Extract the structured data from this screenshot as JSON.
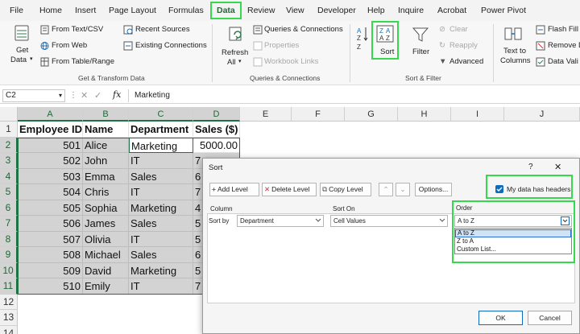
{
  "menu_tabs": [
    "File",
    "Home",
    "Insert",
    "Page Layout",
    "Formulas",
    "Data",
    "Review",
    "View",
    "Developer",
    "Help",
    "Inquire",
    "Acrobat",
    "Power Pivot"
  ],
  "active_tab": "Data",
  "ribbon": {
    "get_data": "Get",
    "get_data2": "Data",
    "from_text_csv": "From Text/CSV",
    "from_web": "From Web",
    "from_table_range": "From Table/Range",
    "recent_sources": "Recent Sources",
    "existing_connections": "Existing Connections",
    "group_get_transform": "Get & Transform Data",
    "refresh": "Refresh",
    "refresh_all": "All",
    "queries_connections": "Queries & Connections",
    "properties": "Properties",
    "workbook_links": "Workbook Links",
    "group_queries": "Queries & Connections",
    "sort": "Sort",
    "filter": "Filter",
    "clear": "Clear",
    "reapply": "Reapply",
    "advanced": "Advanced",
    "group_sort_filter": "Sort & Filter",
    "text_to": "Text to",
    "columns": "Columns",
    "flash_fill": "Flash Fill",
    "remove_dup": "Remove D",
    "data_valid": "Data Vali"
  },
  "formula_bar": {
    "name_box": "C2",
    "fx": "fx",
    "value": "Marketing"
  },
  "columns": [
    "A",
    "B",
    "C",
    "D",
    "E",
    "F",
    "G",
    "H",
    "I",
    "J"
  ],
  "rows": [
    "1",
    "2",
    "3",
    "4",
    "5",
    "6",
    "7",
    "8",
    "9",
    "10",
    "11",
    "12",
    "13",
    "14"
  ],
  "table": {
    "headers": [
      "Employee ID",
      "Name",
      "Department",
      "Sales ($)"
    ],
    "rows": [
      [
        "501",
        "Alice",
        "Marketing",
        "5000.00"
      ],
      [
        "502",
        "John",
        "IT",
        "7"
      ],
      [
        "503",
        "Emma",
        "Sales",
        "6"
      ],
      [
        "504",
        "Chris",
        "IT",
        "7"
      ],
      [
        "505",
        "Sophia",
        "Marketing",
        "4"
      ],
      [
        "506",
        "James",
        "Sales",
        "5"
      ],
      [
        "507",
        "Olivia",
        "IT",
        "5"
      ],
      [
        "508",
        "Michael",
        "Sales",
        "6"
      ],
      [
        "509",
        "David",
        "Marketing",
        "5"
      ],
      [
        "510",
        "Emily",
        "IT",
        "7"
      ]
    ]
  },
  "dialog": {
    "title": "Sort",
    "help": "?",
    "close": "✕",
    "add_level": "Add Level",
    "delete_level": "Delete Level",
    "copy_level": "Copy Level",
    "options": "Options...",
    "my_data_has_headers": "My data has headers",
    "headers_checked": true,
    "col_header": "Column",
    "sort_on_header": "Sort On",
    "order_header": "Order",
    "sort_by": "Sort by",
    "column_value": "Department",
    "sort_on_value": "Cell Values",
    "order_value": "A to Z",
    "order_options": [
      "A to Z",
      "Z to A",
      "Custom List..."
    ],
    "ok": "OK",
    "cancel": "Cancel"
  },
  "colors": {
    "excel_green": "#1f7244",
    "highlight_green": "#36d94e",
    "accent_blue": "#0f6cbd",
    "selection_gray": "#d3d3d3"
  }
}
